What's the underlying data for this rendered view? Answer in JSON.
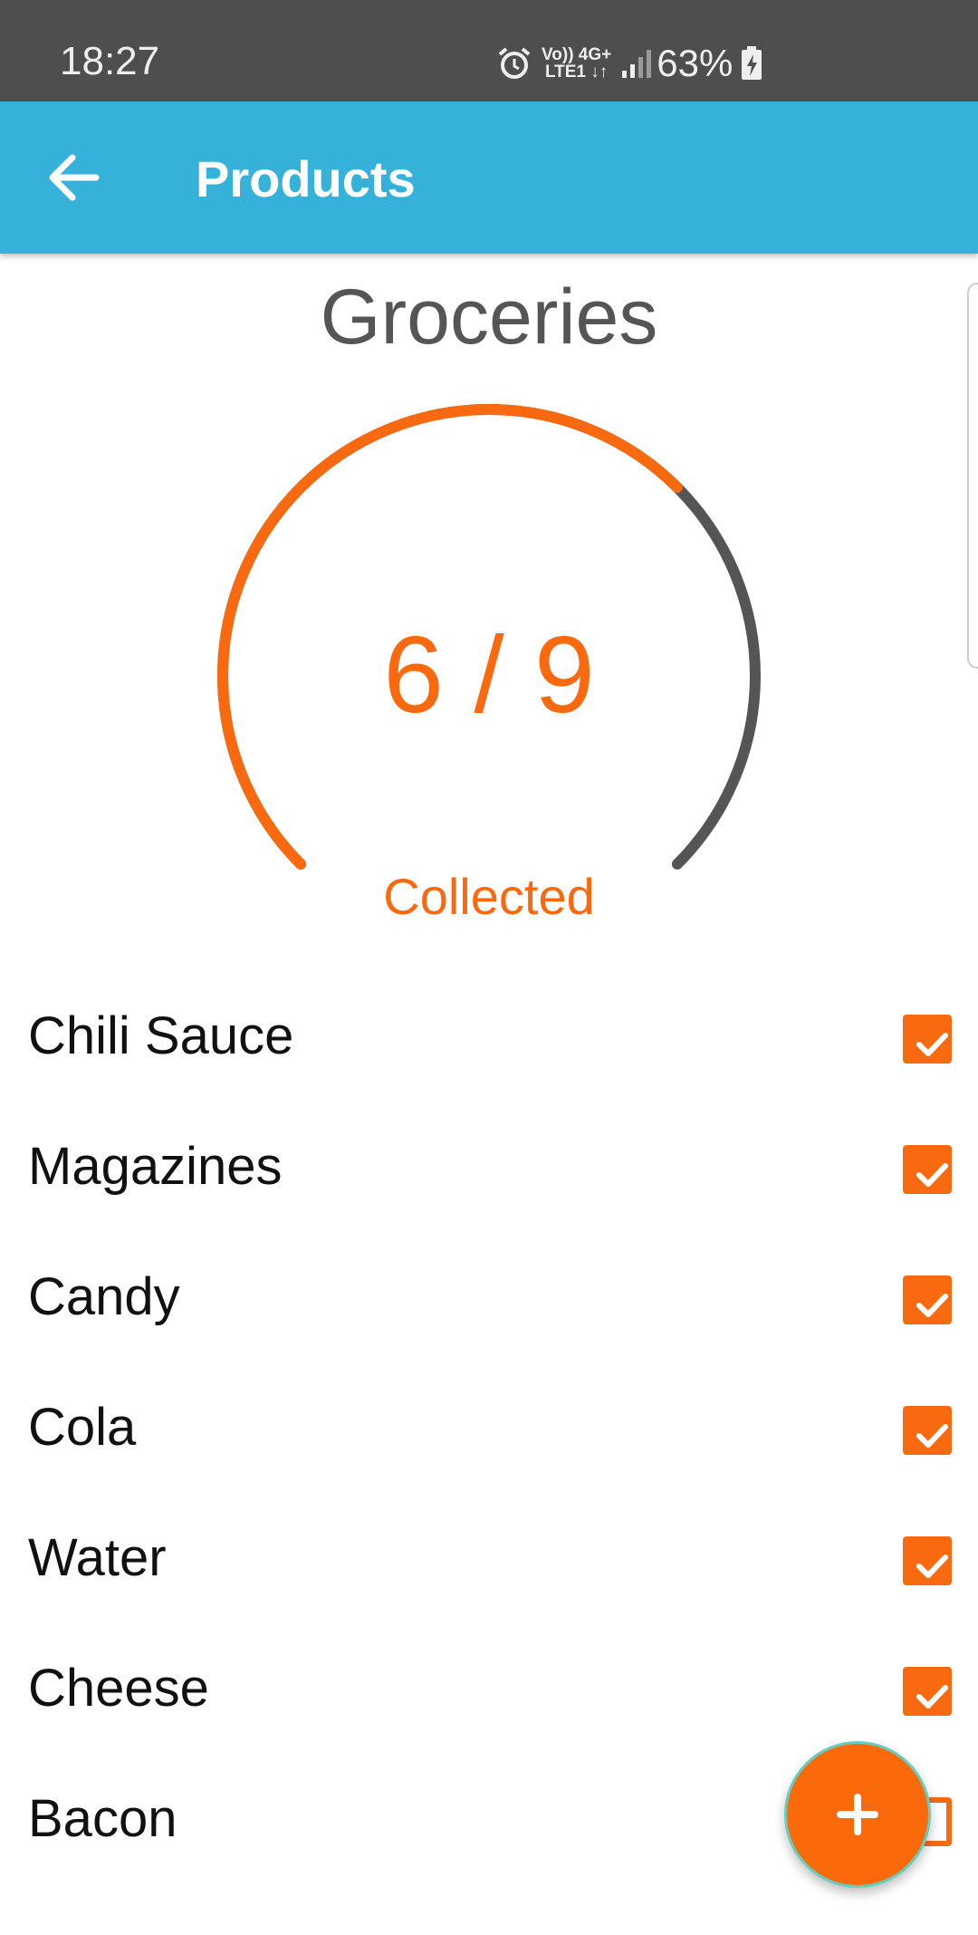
{
  "status_bar": {
    "time": "18:27",
    "network_line1": "Vo)) 4G+",
    "network_line2": "LTE1 ↓↑",
    "battery": "63%",
    "icons": [
      "alarm-icon",
      "signal-icon",
      "battery-charging-icon"
    ]
  },
  "app_bar": {
    "title": "Products",
    "back_icon": "arrow-left-icon",
    "color": "#35b1da"
  },
  "list": {
    "title": "Groceries",
    "collected": 6,
    "total": 9,
    "count_text": "6 / 9",
    "caption": "Collected"
  },
  "products": [
    {
      "name": "Chili Sauce",
      "checked": true
    },
    {
      "name": "Magazines",
      "checked": true
    },
    {
      "name": "Candy",
      "checked": true
    },
    {
      "name": "Cola",
      "checked": true
    },
    {
      "name": "Water",
      "checked": true
    },
    {
      "name": "Cheese",
      "checked": true
    },
    {
      "name": "Bacon",
      "checked": false
    }
  ],
  "fab": {
    "icon": "plus-icon"
  },
  "colors": {
    "accent": "#f96a10",
    "track": "#555555",
    "text": "#111111"
  }
}
